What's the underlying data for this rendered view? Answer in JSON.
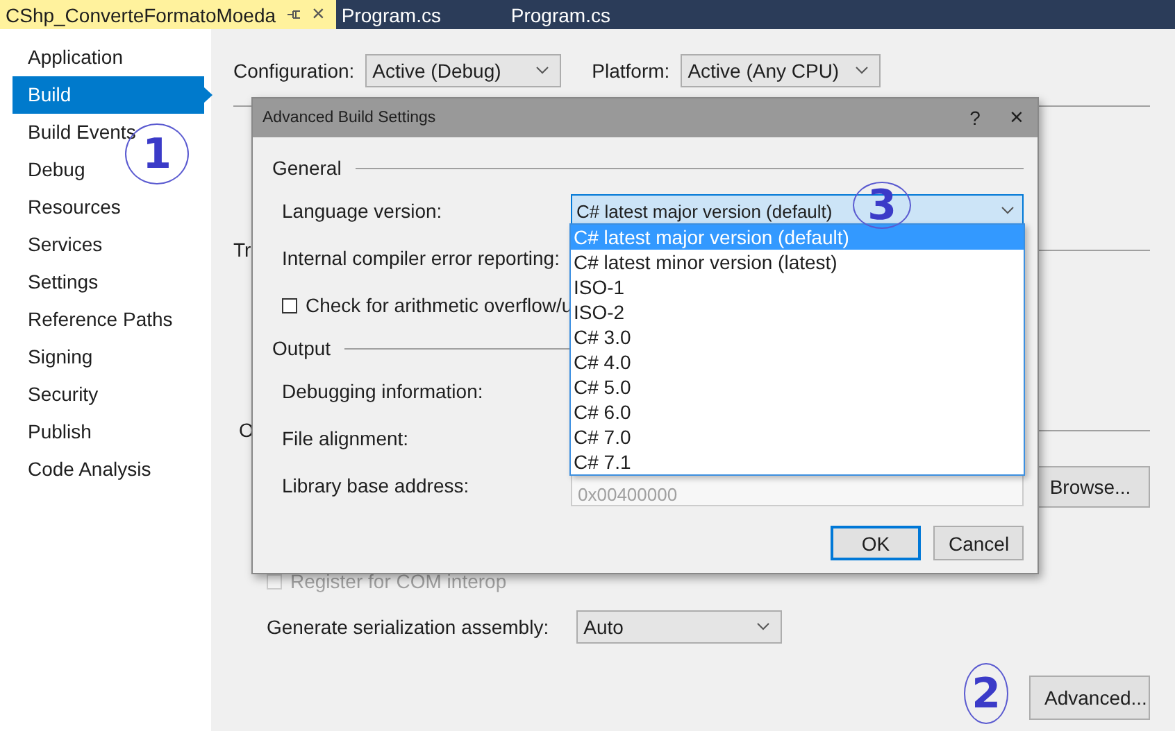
{
  "tabs": [
    {
      "label": "CShp_ConverteFormatoMoeda",
      "selected": true,
      "pinned": true,
      "close": "×"
    },
    {
      "label": "Program.cs",
      "selected": false,
      "pinned": false
    },
    {
      "label": "Program.cs",
      "selected": false,
      "pinned": false
    }
  ],
  "sidebar": {
    "items": [
      {
        "label": "Application",
        "selected": false
      },
      {
        "label": "Build",
        "selected": true
      },
      {
        "label": "Build Events",
        "selected": false
      },
      {
        "label": "Debug",
        "selected": false
      },
      {
        "label": "Resources",
        "selected": false
      },
      {
        "label": "Services",
        "selected": false
      },
      {
        "label": "Settings",
        "selected": false
      },
      {
        "label": "Reference Paths",
        "selected": false
      },
      {
        "label": "Signing",
        "selected": false
      },
      {
        "label": "Security",
        "selected": false
      },
      {
        "label": "Publish",
        "selected": false
      },
      {
        "label": "Code Analysis",
        "selected": false
      }
    ]
  },
  "configuration": {
    "label": "Configuration:",
    "value": "Active (Debug)"
  },
  "platform": {
    "label": "Platform:",
    "value": "Active (Any CPU)"
  },
  "page": {
    "fragment_1": "Tr",
    "fragment_2": "O",
    "browse_button": "Browse...",
    "com_interop": {
      "label": "Register for COM interop",
      "checked": false,
      "disabled": true
    },
    "serialization": {
      "label": "Generate serialization assembly:",
      "value": "Auto"
    },
    "advanced_button": "Advanced..."
  },
  "dialog": {
    "title": "Advanced Build Settings",
    "help": "?",
    "close": "×",
    "sections": [
      {
        "title": "General",
        "rows": [
          {
            "kind": "combo",
            "label": "Language version:",
            "value": "C# latest major version (default)"
          },
          {
            "kind": "label",
            "label": "Internal compiler error reporting:"
          },
          {
            "kind": "checkbox",
            "label": "Check for arithmetic overflow/u",
            "checked": false
          }
        ]
      },
      {
        "title": "Output",
        "rows": [
          {
            "kind": "label",
            "label": "Debugging information:"
          },
          {
            "kind": "label",
            "label": "File alignment:"
          },
          {
            "kind": "field",
            "label": "Library base address:",
            "value": "0x00400000"
          }
        ]
      }
    ],
    "buttons": [
      {
        "label": "OK",
        "default": true
      },
      {
        "label": "Cancel",
        "default": false
      }
    ]
  },
  "dropdown": {
    "items": [
      {
        "label": "C# latest major version (default)",
        "selected": true
      },
      {
        "label": "C# latest minor version (latest)",
        "selected": false
      },
      {
        "label": "ISO-1",
        "selected": false
      },
      {
        "label": "ISO-2",
        "selected": false
      },
      {
        "label": "C# 3.0",
        "selected": false
      },
      {
        "label": "C# 4.0",
        "selected": false
      },
      {
        "label": "C# 5.0",
        "selected": false
      },
      {
        "label": "C# 6.0",
        "selected": false
      },
      {
        "label": "C# 7.0",
        "selected": false
      },
      {
        "label": "C# 7.1",
        "selected": false
      }
    ]
  },
  "callouts": [
    "1",
    "2",
    "3"
  ]
}
